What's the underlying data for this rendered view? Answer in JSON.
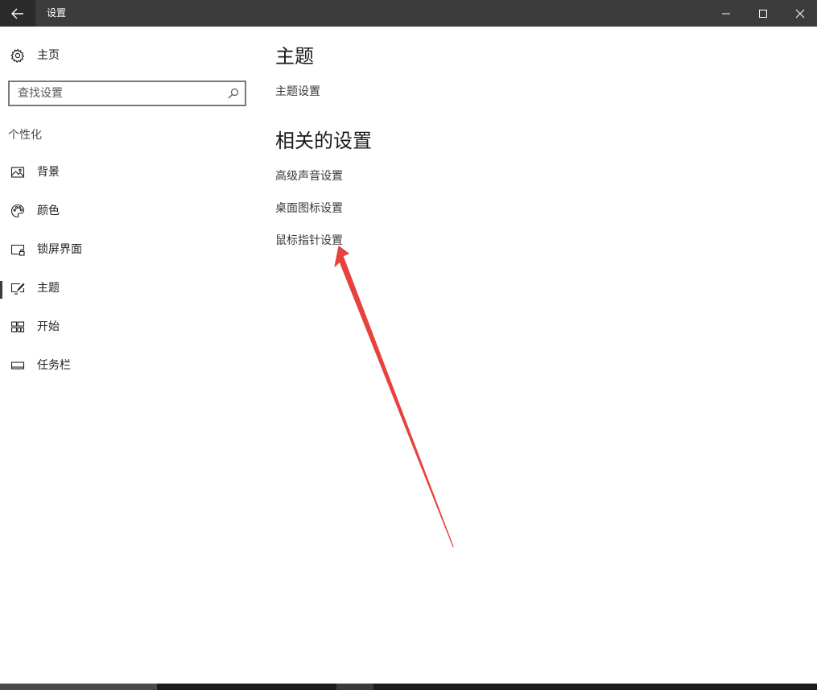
{
  "window": {
    "title": "设置"
  },
  "sidebar": {
    "home_label": "主页",
    "search_placeholder": "查找设置",
    "section_label": "个性化",
    "items": [
      {
        "label": "背景",
        "icon": "image-icon"
      },
      {
        "label": "颜色",
        "icon": "palette-icon"
      },
      {
        "label": "锁屏界面",
        "icon": "lock-screen-icon"
      },
      {
        "label": "主题",
        "icon": "theme-icon",
        "active": true
      },
      {
        "label": "开始",
        "icon": "start-icon"
      },
      {
        "label": "任务栏",
        "icon": "taskbar-icon"
      }
    ]
  },
  "main": {
    "title": "主题",
    "theme_settings_link": "主题设置",
    "related_title": "相关的设置",
    "related_links": [
      "高级声音设置",
      "桌面图标设置",
      "鼠标指针设置"
    ]
  },
  "colors": {
    "titlebar": "#3c3c3c",
    "annotation_arrow": "#e8423f"
  }
}
